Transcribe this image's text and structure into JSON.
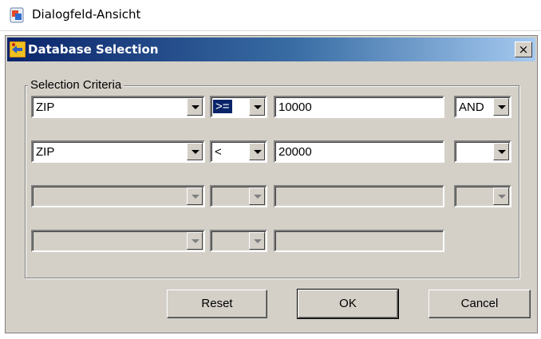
{
  "window": {
    "caption": "Dialogfeld-Ansicht",
    "app_icon": "dialog-app-icon"
  },
  "dialog": {
    "title": "Database Selection",
    "title_icon": "database-selection-icon",
    "close_label": "×",
    "colors": {
      "titlebar_start": "#0a246a",
      "titlebar_end": "#a6caf0",
      "face": "#d4d0c8"
    }
  },
  "criteria": {
    "group_label": "Selection Criteria",
    "rows": [
      {
        "field": "ZIP",
        "operator": ">=",
        "value": "10000",
        "logic": "AND",
        "enabled": true
      },
      {
        "field": "ZIP",
        "operator": "<",
        "value": "20000",
        "logic": "",
        "enabled": true
      },
      {
        "field": "",
        "operator": "",
        "value": "",
        "logic": "",
        "enabled": false
      },
      {
        "field": "",
        "operator": "",
        "value": "",
        "enabled": false
      }
    ]
  },
  "buttons": {
    "reset": "Reset",
    "ok": "OK",
    "cancel": "Cancel"
  }
}
